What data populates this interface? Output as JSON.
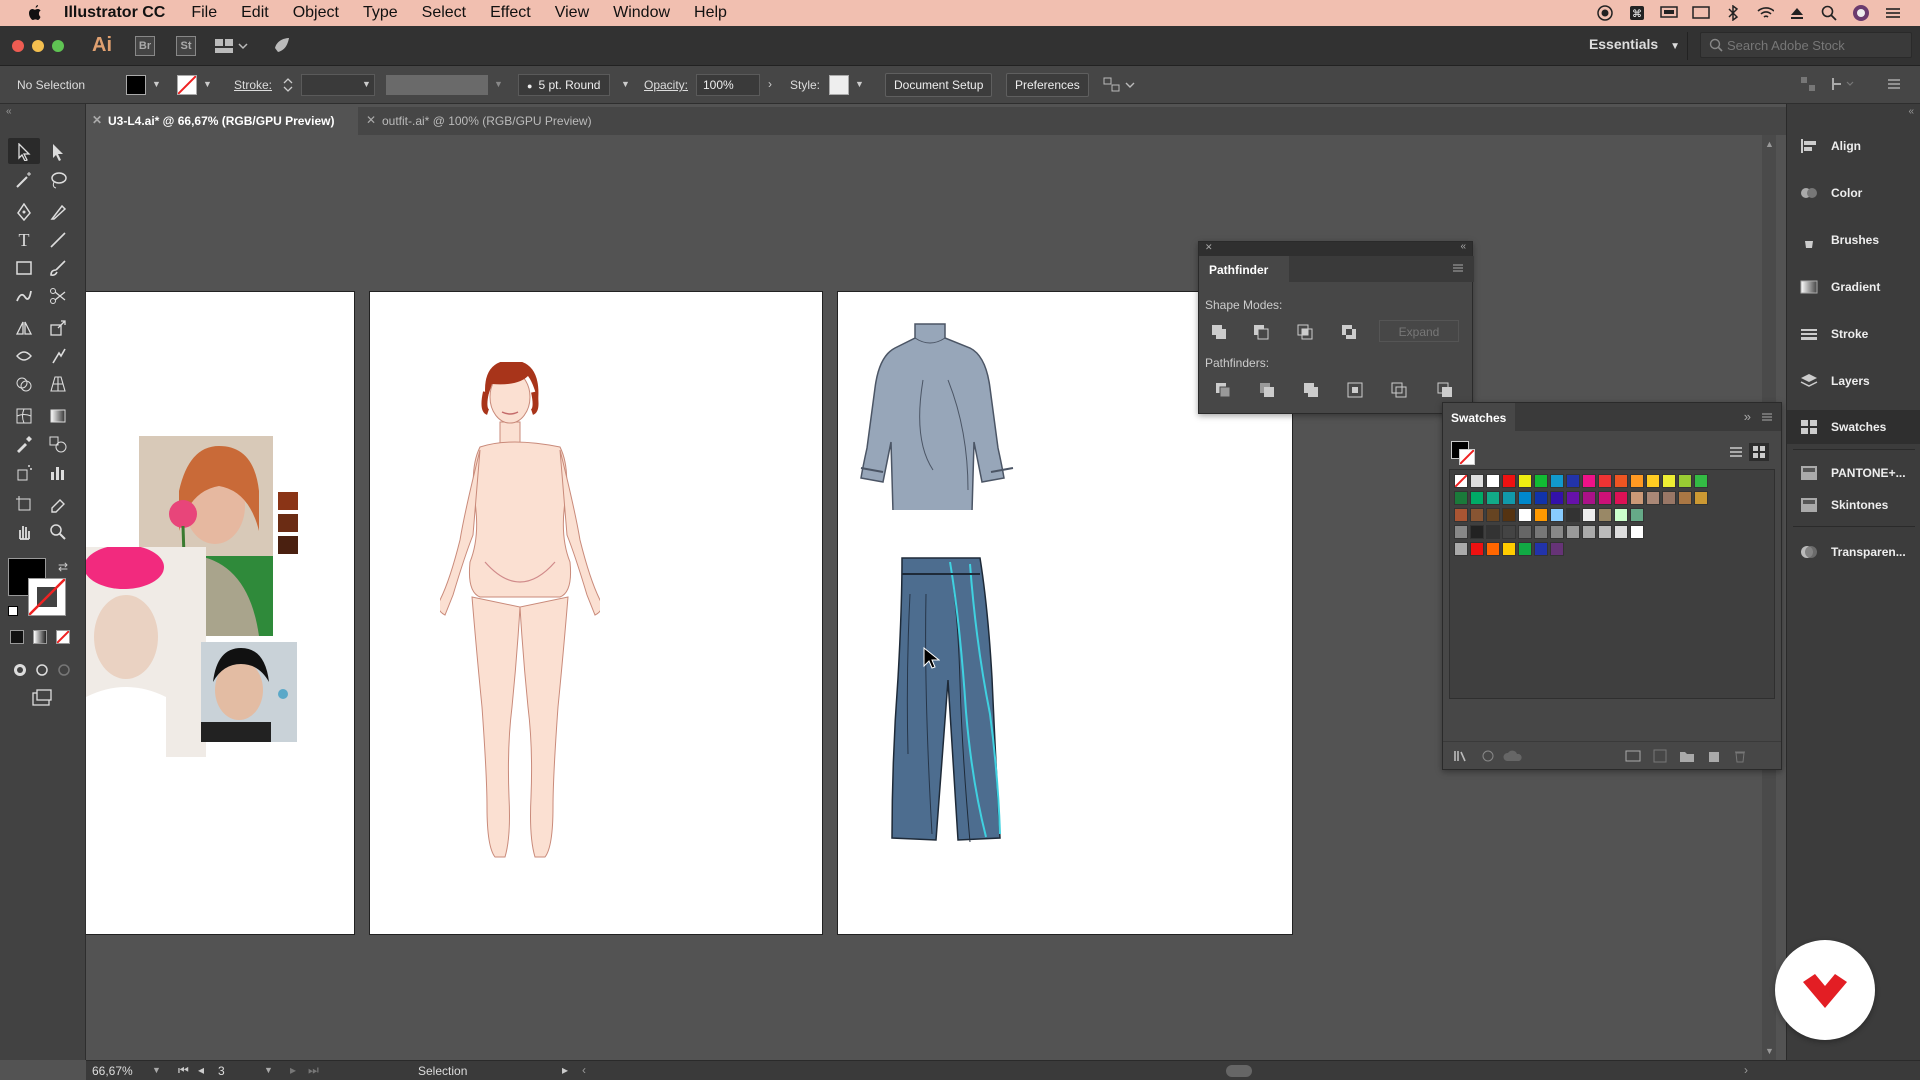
{
  "menubar": {
    "app_name": "Illustrator CC",
    "items": [
      "File",
      "Edit",
      "Object",
      "Type",
      "Select",
      "Effect",
      "View",
      "Window",
      "Help"
    ]
  },
  "appbar": {
    "logo": "Ai",
    "bridge": "Br",
    "stock": "St",
    "workspace": "Essentials",
    "search_placeholder": "Search Adobe Stock"
  },
  "control": {
    "selection": "No Selection",
    "stroke_label": "Stroke:",
    "brush": "5 pt. Round",
    "opacity_label": "Opacity:",
    "opacity_value": "100%",
    "style_label": "Style:",
    "doc_setup": "Document Setup",
    "preferences": "Preferences"
  },
  "tabs": [
    {
      "label": "U3-L4.ai* @ 66,67% (RGB/GPU Preview)"
    },
    {
      "label": "outfit-.ai* @ 100% (RGB/GPU Preview)"
    }
  ],
  "pathfinder": {
    "title": "Pathfinder",
    "shape_modes": "Shape Modes:",
    "expand": "Expand",
    "pathfinders": "Pathfinders:"
  },
  "swatches": {
    "title": "Swatches"
  },
  "dock": [
    "Align",
    "Color",
    "Brushes",
    "Gradient",
    "Stroke",
    "Layers",
    "Swatches",
    "PANTONE+...",
    "Skintones",
    "Transparen..."
  ],
  "status": {
    "zoom": "66,67%",
    "artboard": "3",
    "tool": "Selection"
  },
  "colors": {
    "menubar": "#f1bfb0",
    "accent_brand": "#e31e24"
  }
}
